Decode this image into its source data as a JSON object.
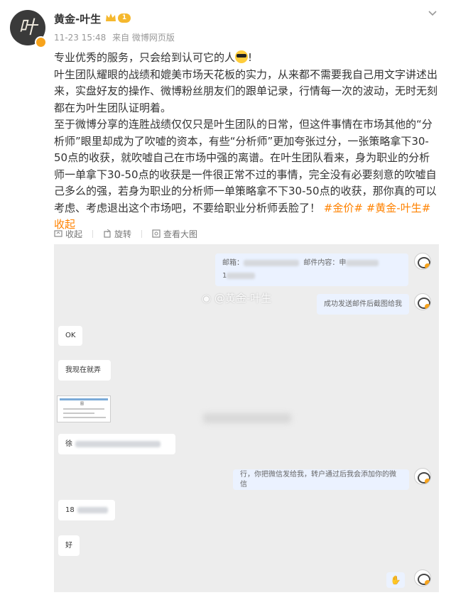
{
  "post": {
    "author": "黄金-叶生",
    "level": "1",
    "avatar_char": "叶",
    "time": "11-23 15:48",
    "source": "来自 微博网页版",
    "line1": "专业优秀的服务，只会给到认可它的人",
    "line1_end": "!",
    "para2": "叶生团队耀眼的战绩和媲美市场天花板的实力，从来都不需要我自己用文字讲述出来，实盘好友的操作、微博粉丝朋友们的跟单记录，行情每一次的波动，无时无刻都在为叶生团队证明着。",
    "para3": "至于微博分享的连胜战绩仅仅只是叶生团队的日常，但这件事情在市场其他的“分析师”眼里却成为了吹嘘的资本，有些“分析师”更加夸张过分，一张策略拿下30-50点的收获，就吹嘘自己在市场中强的离谱。在叶生团队看来，身为职业的分析师一单拿下30-50点的收获是一件很正常不过的事情，完全没有必要刻意的吹嘘自己多么的强，若身为职业的分析师一单策略拿不下30-50点的收获，那你真的可以考虑、考虑退出这个市场吧，不要给职业分析师丢脸了！",
    "tag1": "#金价#",
    "tag2": "#黄金-叶生#",
    "collapse": "收起"
  },
  "actions": {
    "collect": "收起",
    "rotate": "旋转",
    "view_large": "查看大图"
  },
  "chat": {
    "msg1_a": "邮箱：",
    "msg1_b": "邮件内容：申",
    "msg1_c": "1",
    "watermark": "@黄金-叶生",
    "msg2": "成功发送邮件后截图给我",
    "msg3": "OK",
    "msg4": "我现在就弄",
    "msg5": "徐",
    "msg6": "行，你把微信发给我，转户通过后我会添加你的微信",
    "msg7": "18",
    "msg8": "好",
    "thumb_text": "图"
  },
  "colors": {
    "tag": "#ff8200",
    "chat_bg": "#ededed",
    "right_bubble": "#ebf2ff"
  }
}
